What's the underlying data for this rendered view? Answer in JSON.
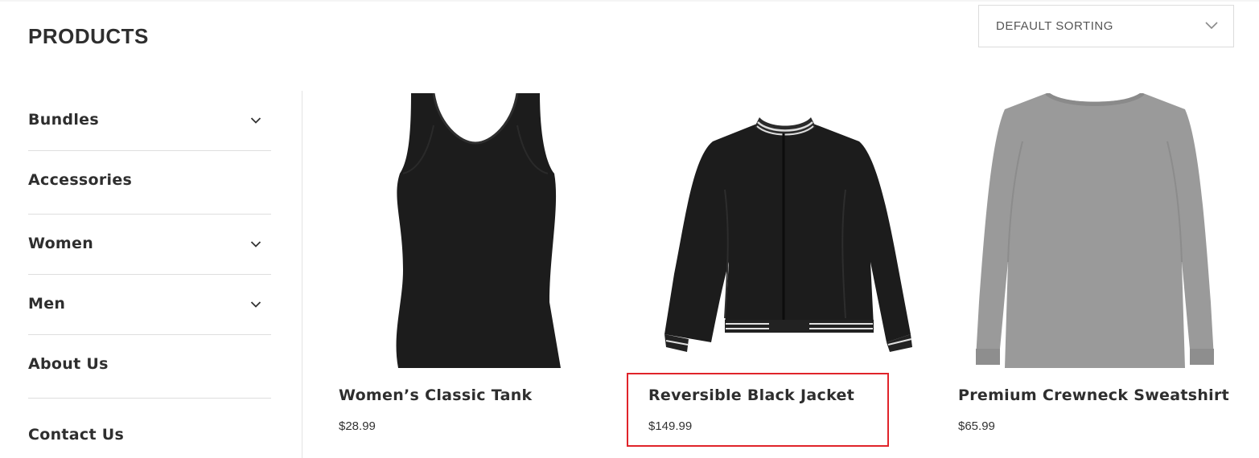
{
  "page": {
    "title": "PRODUCTS"
  },
  "sorting": {
    "selected": "DEFAULT SORTING",
    "icon": "chevron-down-icon"
  },
  "sidebar": {
    "items": [
      {
        "label": "Bundles",
        "expandable": true
      },
      {
        "label": "Accessories",
        "expandable": false
      },
      {
        "label": "Women",
        "expandable": true
      },
      {
        "label": "Men",
        "expandable": true
      },
      {
        "label": "About Us",
        "expandable": false
      },
      {
        "label": "Contact Us",
        "expandable": false
      }
    ]
  },
  "products": [
    {
      "name": "Women’s Classic Tank",
      "price": "$28.99",
      "image": "black-tank-top"
    },
    {
      "name": "Reversible Black Jacket",
      "price": "$149.99",
      "image": "black-bomber-jacket",
      "highlighted": true
    },
    {
      "name": "Premium Crewneck Sweatshirt",
      "price": "$65.99",
      "image": "grey-crewneck-sweatshirt"
    }
  ],
  "colors": {
    "highlight": "#e0242a",
    "text": "#2e2e2e",
    "sweatshirt": "#9a9a9a",
    "garment_black": "#1c1c1c"
  }
}
